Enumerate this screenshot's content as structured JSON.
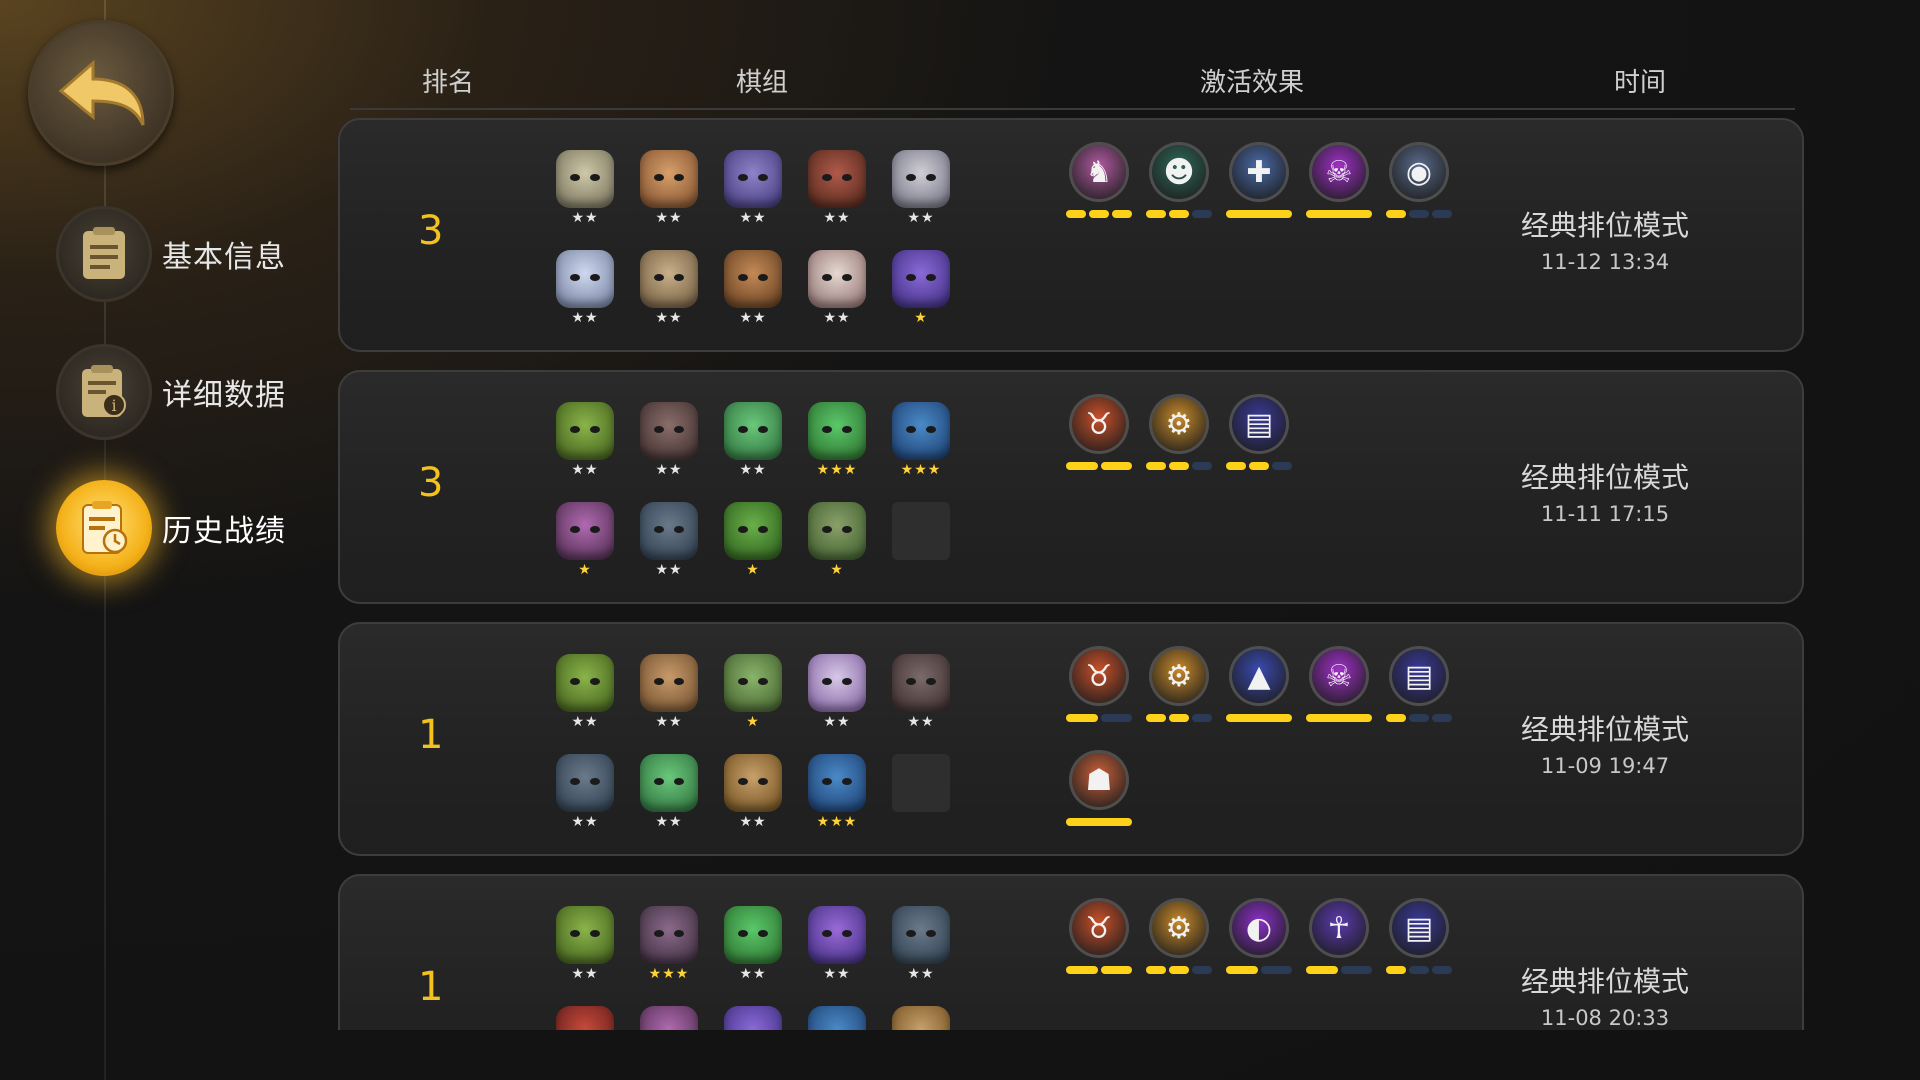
{
  "nav": {
    "back_icon": "back-arrow-icon",
    "items": [
      {
        "label": "基本信息",
        "icon": "document-icon",
        "active": false
      },
      {
        "label": "详细数据",
        "icon": "document-info-icon",
        "active": false
      },
      {
        "label": "历史战绩",
        "icon": "history-clock-icon",
        "active": true
      }
    ]
  },
  "header": {
    "rank": "排名",
    "lineup": "棋组",
    "synergy": "激活效果",
    "time": "时间"
  },
  "records": [
    {
      "rank": "3",
      "mode": "经典排位模式",
      "time": "11-12 13:34",
      "pieces": [
        {
          "stars": "★★",
          "color": "#cfc8a8",
          "color2": "#6e6a55"
        },
        {
          "stars": "★★",
          "color": "#d8a06a",
          "color2": "#7a4a2a"
        },
        {
          "stars": "★★",
          "color": "#8f83c9",
          "color2": "#3d3575"
        },
        {
          "stars": "★★",
          "color": "#b05a4a",
          "color2": "#4a2418"
        },
        {
          "stars": "★★",
          "color": "#d0cfd8",
          "color2": "#6a6a7a"
        },
        {
          "stars": "★★",
          "color": "#cfd8ee",
          "color2": "#6e7a9a"
        },
        {
          "stars": "★★",
          "color": "#c9b08a",
          "color2": "#6a553a"
        },
        {
          "stars": "★★",
          "color": "#c48a55",
          "color2": "#5e3a1e"
        },
        {
          "stars": "★★",
          "color": "#e6d8d0",
          "color2": "#8a6a6a"
        },
        {
          "stars": "★",
          "color": "#8a6ad8",
          "color2": "#3a2a7a"
        }
      ],
      "traits": [
        {
          "icon": "knight-icon",
          "color": "#b05aa0",
          "segments": [
            1,
            1,
            1
          ]
        },
        {
          "icon": "goblin-icon",
          "color": "#2f6a5a",
          "segments": [
            1,
            1,
            0
          ]
        },
        {
          "icon": "cross-icon",
          "color": "#4a6aa8",
          "segments": [
            1
          ]
        },
        {
          "icon": "demon-icon",
          "color": "#a030c8",
          "segments": [
            1
          ]
        },
        {
          "icon": "guardian-icon",
          "color": "#5a6a8a",
          "segments": [
            1,
            0,
            0
          ]
        }
      ]
    },
    {
      "rank": "3",
      "mode": "经典排位模式",
      "time": "11-11 17:15",
      "pieces": [
        {
          "stars": "★★",
          "color": "#8ab44a",
          "color2": "#3e5a1a"
        },
        {
          "stars": "★★",
          "color": "#8a6e6a",
          "color2": "#3a2a2a"
        },
        {
          "stars": "★★",
          "color": "#6ac87a",
          "color2": "#2a6a3a"
        },
        {
          "stars": "★★★",
          "color": "#5ac86a",
          "color2": "#2a6a2a"
        },
        {
          "stars": "★★★",
          "color": "#4a8ac8",
          "color2": "#1a3a6a"
        },
        {
          "stars": "★",
          "color": "#b06ab0",
          "color2": "#4a2a4a"
        },
        {
          "stars": "★★",
          "color": "#6a7a8a",
          "color2": "#2a3a4a"
        },
        {
          "stars": "★",
          "color": "#6ab04a",
          "color2": "#2a5a1a"
        },
        {
          "stars": "★",
          "color": "#8aa06a",
          "color2": "#3a5a2a"
        }
      ],
      "traits": [
        {
          "icon": "horned-beast-icon",
          "color": "#c8502a",
          "segments": [
            1,
            1
          ]
        },
        {
          "icon": "gear-icon",
          "color": "#c88a2a",
          "segments": [
            1,
            1,
            0
          ]
        },
        {
          "icon": "mage-book-icon",
          "color": "#3a3a9a",
          "segments": [
            1,
            1,
            0
          ]
        }
      ]
    },
    {
      "rank": "1",
      "mode": "经典排位模式",
      "time": "11-09 19:47",
      "pieces": [
        {
          "stars": "★★",
          "color": "#8ab44a",
          "color2": "#3e5a1a"
        },
        {
          "stars": "★★",
          "color": "#c89a6a",
          "color2": "#6a4a2a"
        },
        {
          "stars": "★",
          "color": "#8ab46a",
          "color2": "#3e5a2a"
        },
        {
          "stars": "★★",
          "color": "#d8c8e8",
          "color2": "#7a5a9a"
        },
        {
          "stars": "★★",
          "color": "#7a6a6a",
          "color2": "#3a2a2a"
        },
        {
          "stars": "★★",
          "color": "#6a7a8a",
          "color2": "#2a3a4a"
        },
        {
          "stars": "★★",
          "color": "#6ac87a",
          "color2": "#2a6a3a"
        },
        {
          "stars": "★★",
          "color": "#c8a06a",
          "color2": "#6a4a1a"
        },
        {
          "stars": "★★★",
          "color": "#4a8ac8",
          "color2": "#1a3a6a"
        }
      ],
      "traits": [
        {
          "icon": "horned-beast-icon",
          "color": "#c8502a",
          "segments": [
            1,
            0
          ]
        },
        {
          "icon": "gear-icon",
          "color": "#c88a2a",
          "segments": [
            1,
            1,
            0
          ]
        },
        {
          "icon": "wizard-hat-icon",
          "color": "#3a4ab0",
          "segments": [
            1
          ]
        },
        {
          "icon": "demon-icon",
          "color": "#a030c8",
          "segments": [
            1
          ]
        },
        {
          "icon": "mage-book-icon",
          "color": "#3a3a9a",
          "segments": [
            1,
            0,
            0
          ]
        },
        {
          "icon": "viking-icon",
          "color": "#c8603a",
          "segments": [
            1
          ]
        }
      ]
    },
    {
      "rank": "1",
      "mode": "经典排位模式",
      "time": "11-08 20:33",
      "pieces": [
        {
          "stars": "★★",
          "color": "#8ab44a",
          "color2": "#3e5a1a"
        },
        {
          "stars": "★★★",
          "color": "#8a6a8a",
          "color2": "#3a2a3a"
        },
        {
          "stars": "★★",
          "color": "#5ac86a",
          "color2": "#2a6a2a"
        },
        {
          "stars": "★★",
          "color": "#9a6ad8",
          "color2": "#3a2a7a"
        },
        {
          "stars": "★★",
          "color": "#6a7a8a",
          "color2": "#2a3a4a"
        },
        {
          "stars": "",
          "color": "#c84a3a",
          "color2": "#5a1a1a"
        },
        {
          "stars": "",
          "color": "#b06ab0",
          "color2": "#4a2a4a"
        },
        {
          "stars": "",
          "color": "#8a6ad8",
          "color2": "#3a2a7a"
        },
        {
          "stars": "",
          "color": "#4a8ac8",
          "color2": "#1a3a6a"
        },
        {
          "stars": "",
          "color": "#c8a06a",
          "color2": "#6a4a1a"
        }
      ],
      "traits": [
        {
          "icon": "horned-beast-icon",
          "color": "#c8502a",
          "segments": [
            1,
            1
          ]
        },
        {
          "icon": "gear-icon",
          "color": "#c88a2a",
          "segments": [
            1,
            1,
            0
          ]
        },
        {
          "icon": "assassin-icon",
          "color": "#8a30c8",
          "segments": [
            1,
            0
          ]
        },
        {
          "icon": "undead-icon",
          "color": "#5a3ab0",
          "segments": [
            1,
            0
          ]
        },
        {
          "icon": "mage-book-icon",
          "color": "#3a3a9a",
          "segments": [
            1,
            0,
            0
          ]
        }
      ]
    }
  ]
}
